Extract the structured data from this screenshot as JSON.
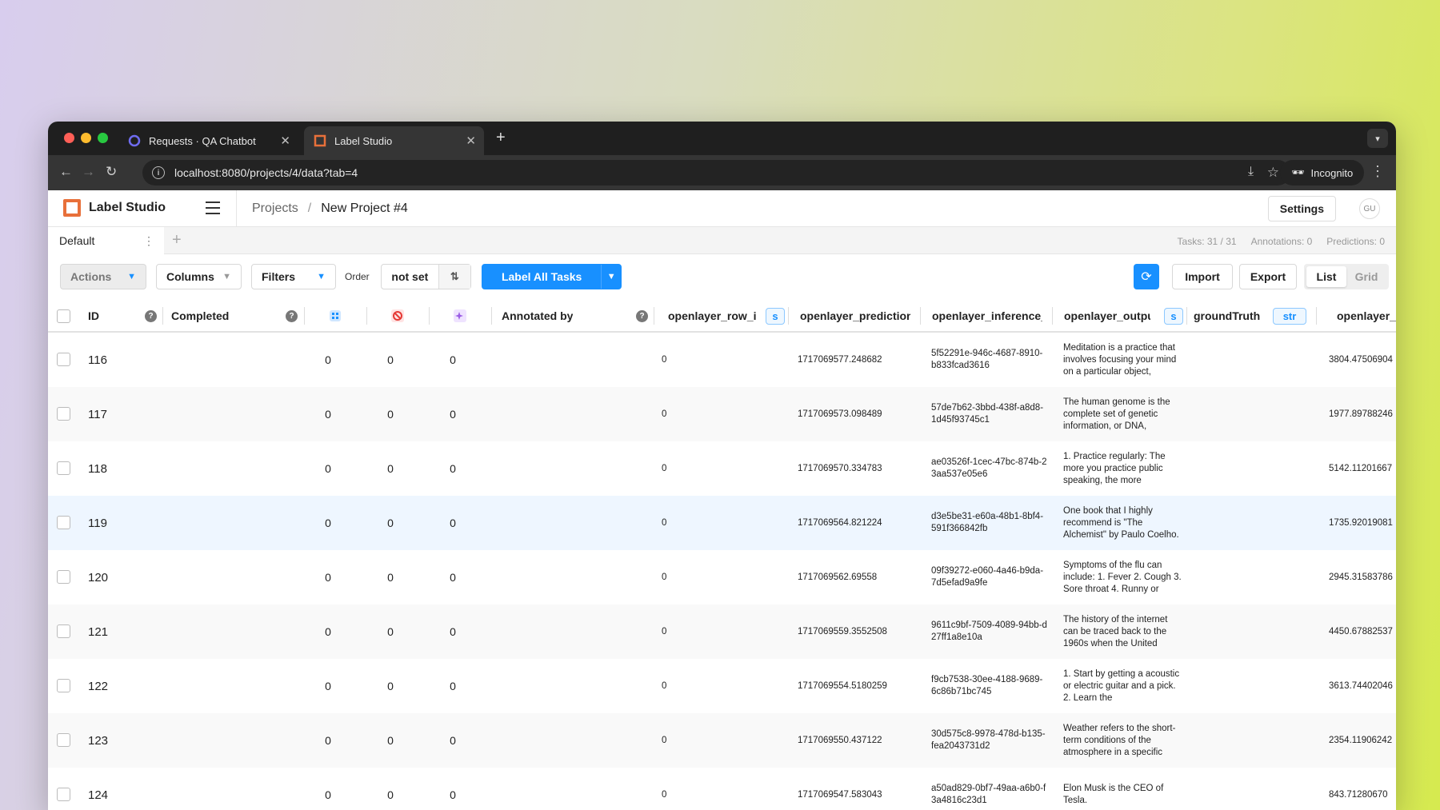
{
  "browser": {
    "tabs": [
      {
        "title": "Requests · QA Chatbot"
      },
      {
        "title": "Label Studio"
      }
    ],
    "url": "localhost:8080/projects/4/data?tab=4",
    "profile": "Incognito"
  },
  "app": {
    "name": "Label Studio",
    "breadcrumb": {
      "projects": "Projects",
      "separator": "/",
      "current": "New Project #4"
    },
    "settings_label": "Settings",
    "avatar_initials": "GU"
  },
  "view_tabs": {
    "active": "Default",
    "stats": {
      "tasks": "Tasks: 31 / 31",
      "annotations": "Annotations: 0",
      "predictions": "Predictions: 0"
    }
  },
  "toolbar": {
    "actions": "Actions",
    "columns": "Columns",
    "filters": "Filters",
    "order_label": "Order",
    "order_value": "not set",
    "label_all": "Label All Tasks",
    "import": "Import",
    "export": "Export",
    "view_list": "List",
    "view_grid": "Grid"
  },
  "table": {
    "headers": {
      "id": "ID",
      "completed": "Completed",
      "annotated_by": "Annotated by",
      "row_id": "openlayer_row_id",
      "row_id_type": "s",
      "prediction": "openlayer_prediction_t",
      "inference": "openlayer_inference_ic",
      "output": "openlayer_output",
      "output_type": "s",
      "ground_truth": "groundTruth",
      "ground_truth_type": "str",
      "latency": "openlayer_la"
    },
    "rows": [
      {
        "id": "116",
        "total": "0",
        "cancelled": "0",
        "predictions": "0",
        "row_id": "0",
        "prediction": "1717069577.248682",
        "inference": "5f52291e-946c-4687-8910-b833fcad3616",
        "output": "Meditation is a practice that involves focusing your mind on a particular object,",
        "latency": "3804.47506904"
      },
      {
        "id": "117",
        "total": "0",
        "cancelled": "0",
        "predictions": "0",
        "row_id": "0",
        "prediction": "1717069573.098489",
        "inference": "57de7b62-3bbd-438f-a8d8-1d45f93745c1",
        "output": "The human genome is the complete set of genetic information, or DNA,",
        "latency": "1977.89788246"
      },
      {
        "id": "118",
        "total": "0",
        "cancelled": "0",
        "predictions": "0",
        "row_id": "0",
        "prediction": "1717069570.334783",
        "inference": "ae03526f-1cec-47bc-874b-23aa537e05e6",
        "output": "1. Practice regularly: The more you practice public speaking, the more",
        "latency": "5142.11201667"
      },
      {
        "id": "119",
        "total": "0",
        "cancelled": "0",
        "predictions": "0",
        "row_id": "0",
        "prediction": "1717069564.821224",
        "inference": "d3e5be31-e60a-48b1-8bf4-591f366842fb",
        "output": "One book that I highly recommend is \"The Alchemist\" by Paulo Coelho.",
        "latency": "1735.92019081"
      },
      {
        "id": "120",
        "total": "0",
        "cancelled": "0",
        "predictions": "0",
        "row_id": "0",
        "prediction": "1717069562.69558",
        "inference": "09f39272-e060-4a46-b9da-7d5efad9a9fe",
        "output": "Symptoms of the flu can include: 1. Fever 2. Cough 3. Sore throat 4. Runny or",
        "latency": "2945.31583786"
      },
      {
        "id": "121",
        "total": "0",
        "cancelled": "0",
        "predictions": "0",
        "row_id": "0",
        "prediction": "1717069559.3552508",
        "inference": "9611c9bf-7509-4089-94bb-d27ff1a8e10a",
        "output": "The history of the internet can be traced back to the 1960s when the United",
        "latency": "4450.67882537"
      },
      {
        "id": "122",
        "total": "0",
        "cancelled": "0",
        "predictions": "0",
        "row_id": "0",
        "prediction": "1717069554.5180259",
        "inference": "f9cb7538-30ee-4188-9689-6c86b71bc745",
        "output": "1. Start by getting a acoustic or electric guitar and a pick. 2. Learn the",
        "latency": "3613.74402046"
      },
      {
        "id": "123",
        "total": "0",
        "cancelled": "0",
        "predictions": "0",
        "row_id": "0",
        "prediction": "1717069550.437122",
        "inference": "30d575c8-9978-478d-b135-fea2043731d2",
        "output": "Weather refers to the short-term conditions of the atmosphere in a specific",
        "latency": "2354.11906242"
      },
      {
        "id": "124",
        "total": "0",
        "cancelled": "0",
        "predictions": "0",
        "row_id": "0",
        "prediction": "1717069547.583043",
        "inference": "a50ad829-0bf7-49aa-a6b0-f3a4816c23d1",
        "output": "Elon Musk is the CEO of Tesla.",
        "latency": "843.71280670"
      }
    ]
  },
  "colors": {
    "accent": "#1890ff",
    "logo": "#e8703a",
    "close_red": "#ff5f57",
    "min_yellow": "#febc2e",
    "max_green": "#28c840"
  },
  "icons": {
    "total_annotations": "grid-icon",
    "cancelled": "ban-icon",
    "predictions": "sparkle-icon"
  }
}
